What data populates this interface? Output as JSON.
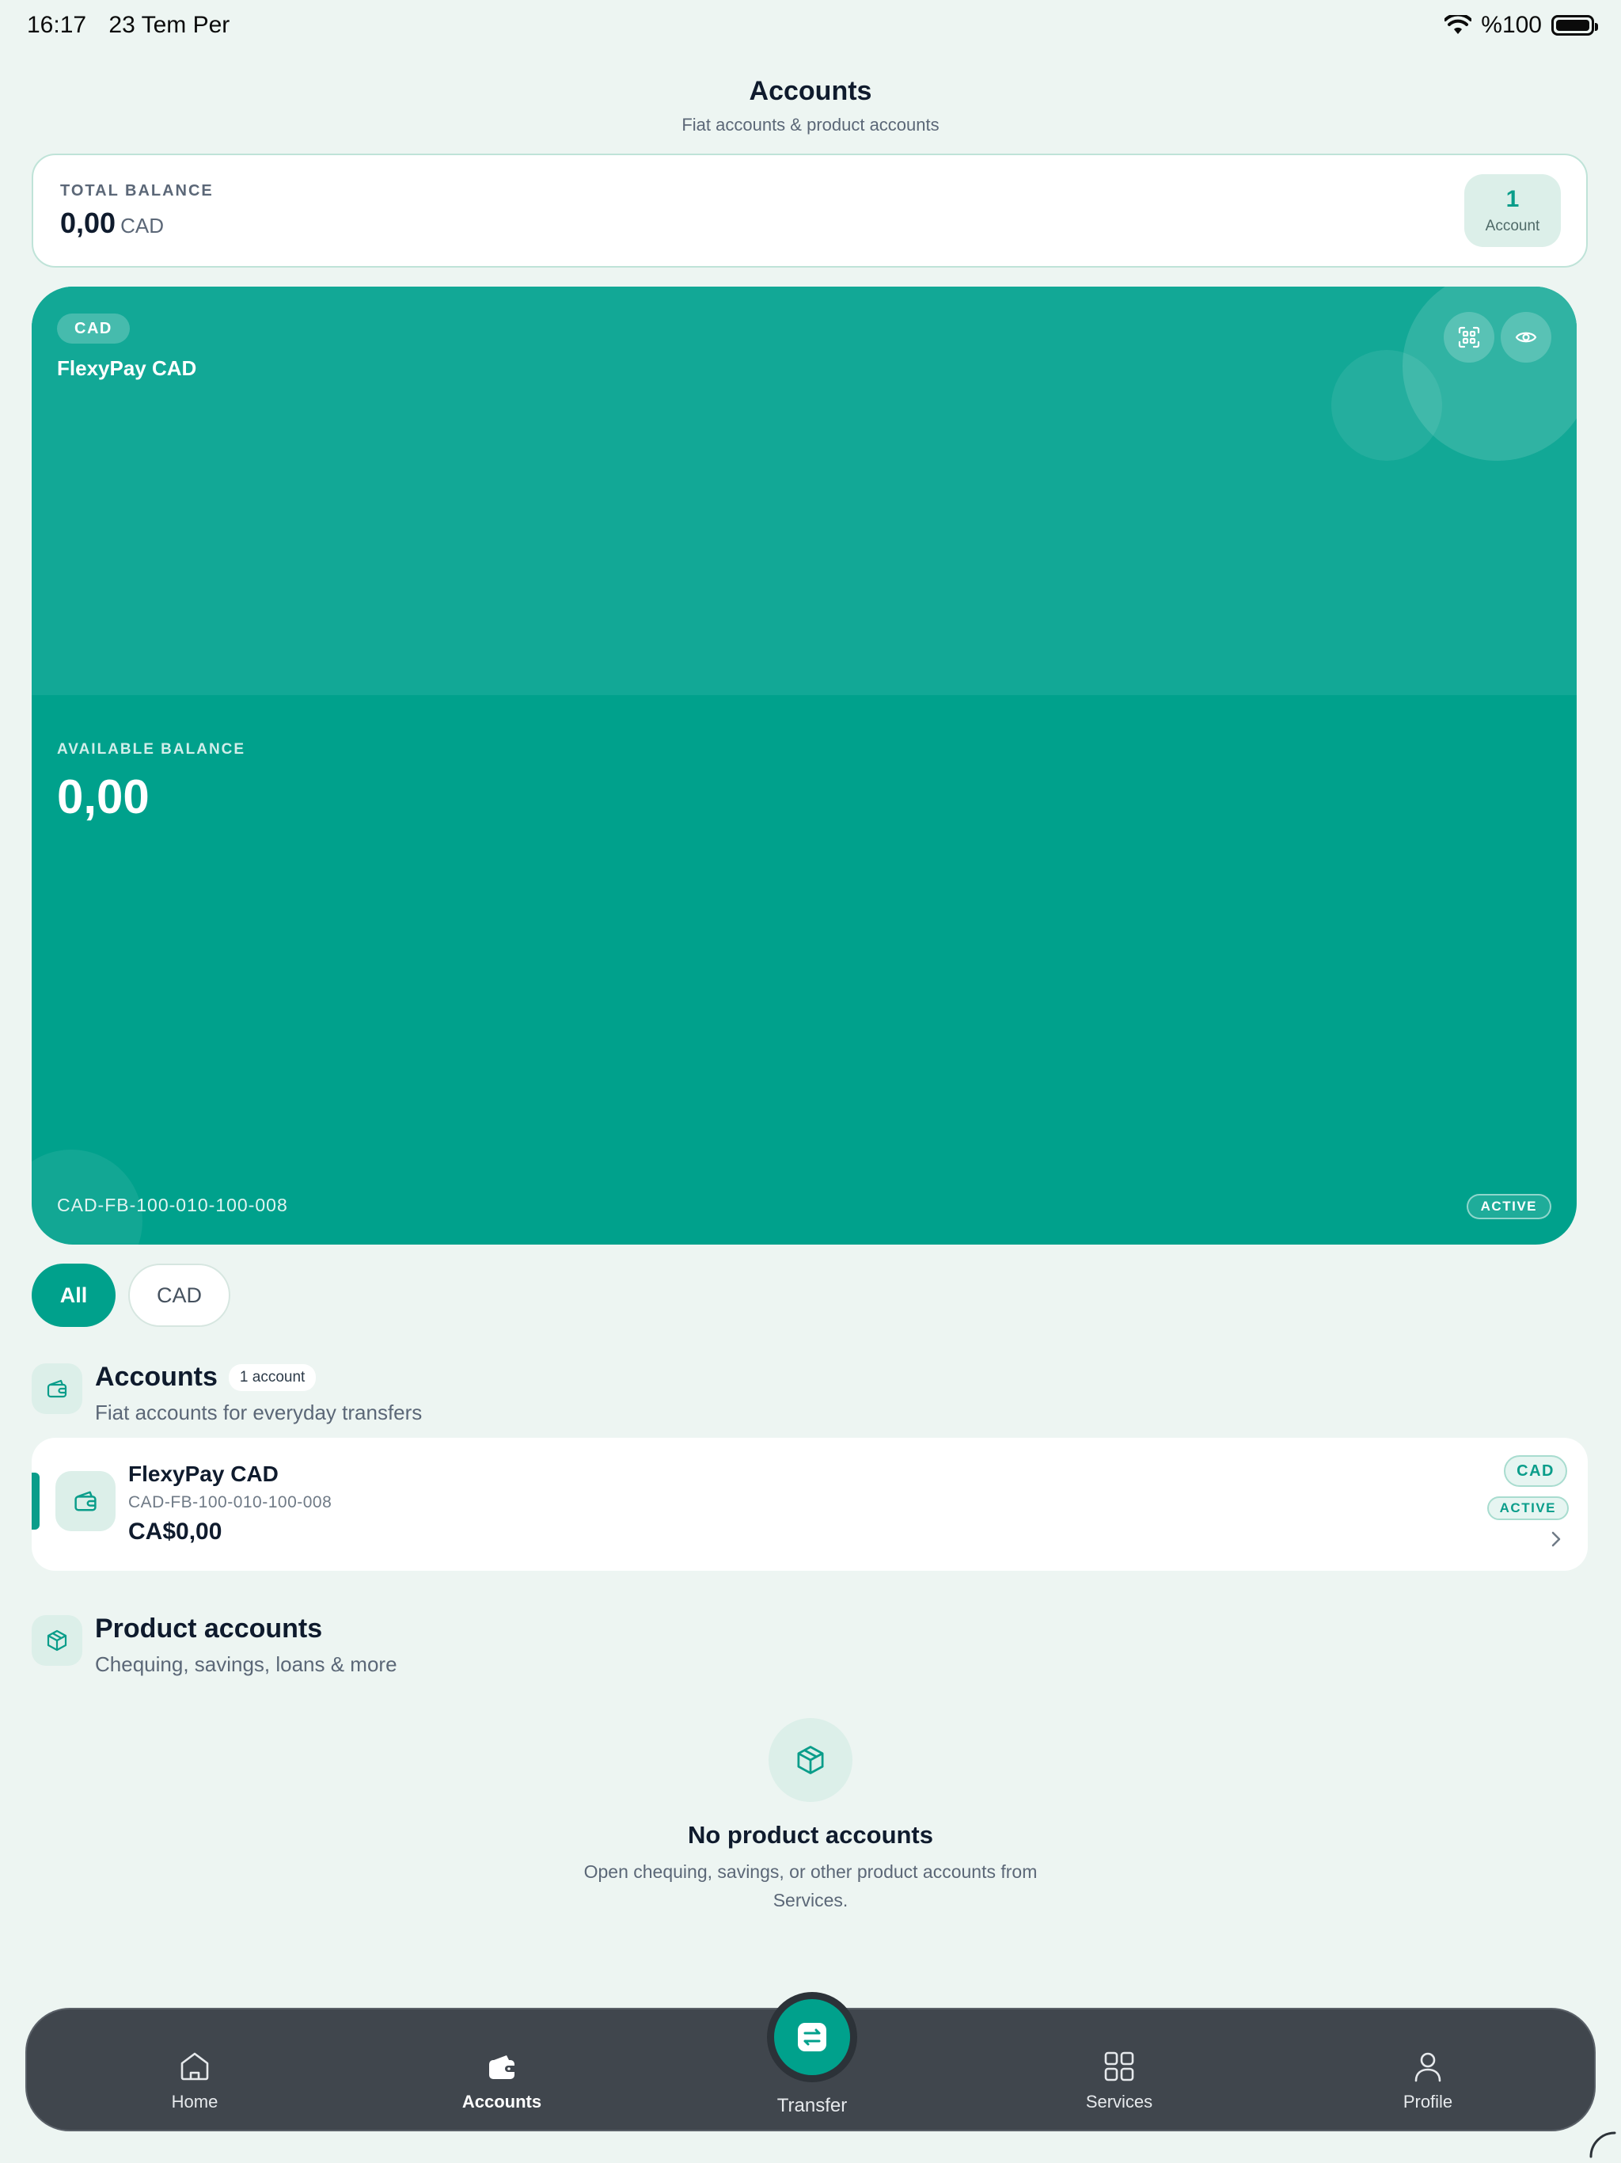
{
  "status_bar": {
    "time": "16:17",
    "date": "23 Tem Per",
    "battery": "%100"
  },
  "header": {
    "title": "Accounts",
    "subtitle": "Fiat accounts & product accounts"
  },
  "total_balance": {
    "label": "TOTAL BALANCE",
    "amount": "0,00",
    "currency": "CAD",
    "count": "1",
    "count_label": "Account"
  },
  "hero_card": {
    "currency_badge": "CAD",
    "name": "FlexyPay CAD",
    "available_label": "AVAILABLE BALANCE",
    "available_amount": "0,00",
    "account_number": "CAD-FB-100-010-100-008",
    "status": "ACTIVE",
    "actions": [
      {
        "icon": "qr-scan-icon"
      },
      {
        "icon": "eye-icon"
      }
    ]
  },
  "filters": [
    {
      "label": "All",
      "selected": true
    },
    {
      "label": "CAD",
      "selected": false
    }
  ],
  "accounts_section": {
    "title": "Accounts",
    "count": "1 account",
    "subtitle": "Fiat accounts for everyday transfers",
    "icon": "wallet-icon",
    "items": [
      {
        "name": "FlexyPay CAD",
        "number": "CAD-FB-100-010-100-008",
        "balance": "CA$0,00",
        "currency": "CAD",
        "status": "ACTIVE"
      }
    ]
  },
  "product_section": {
    "title": "Product accounts",
    "subtitle": "Chequing, savings, loans & more",
    "icon": "package-icon",
    "empty_title": "No product accounts",
    "empty_desc": "Open chequing, savings, or other product accounts from Services."
  },
  "tab_bar": {
    "home": "Home",
    "accounts": "Accounts",
    "transfer": "Transfer",
    "services": "Services",
    "profile": "Profile",
    "active": "accounts"
  },
  "colors": {
    "accent": "#00a18c",
    "background": "#edf5f2",
    "tab_bar": "#40464d"
  }
}
